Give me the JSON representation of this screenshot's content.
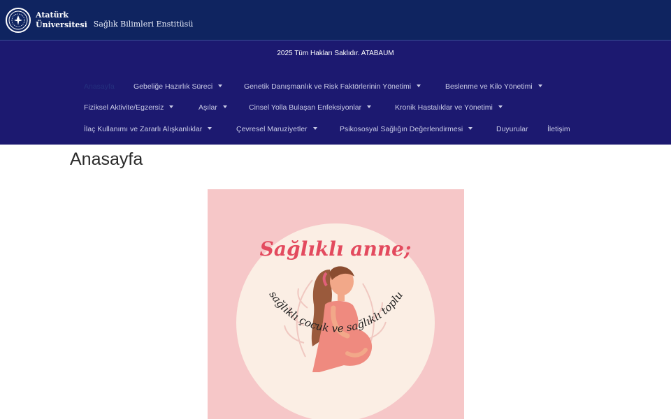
{
  "header": {
    "logo_line1": "Atatürk",
    "logo_line2": "Üniversitesi",
    "institute": "Sağlık Bilimleri Enstitüsü"
  },
  "nav": {
    "copyright": "2025 Tüm Hakları Saklıdır. ATABAUM",
    "home": "Anasayfa",
    "row1": [
      {
        "label": "Gebeliğe Hazırlık Süreci",
        "dropdown": true
      },
      {
        "label": "Genetik Danışmanlık ve Risk Faktörlerinin Yönetimi",
        "dropdown": true
      },
      {
        "label": "Beslenme ve Kilo Yönetimi",
        "dropdown": true
      }
    ],
    "row2": [
      {
        "label": "Fiziksel Aktivite/Egzersiz",
        "dropdown": true
      },
      {
        "label": "Aşılar",
        "dropdown": true
      },
      {
        "label": "Cinsel Yolla Bulaşan Enfeksiyonlar",
        "dropdown": true
      },
      {
        "label": "Kronik Hastalıklar ve Yönetimi",
        "dropdown": true
      }
    ],
    "row3": [
      {
        "label": "İlaç Kullanımı ve Zararlı Alışkanlıklar",
        "dropdown": true
      },
      {
        "label": "Çevresel Maruziyetler",
        "dropdown": true
      },
      {
        "label": "Psikososyal Sağlığın Değerlendirmesi",
        "dropdown": true
      },
      {
        "label": "Duyurular",
        "dropdown": false
      },
      {
        "label": "İletişim",
        "dropdown": false
      }
    ]
  },
  "main": {
    "title": "Anasayfa",
    "poster": {
      "headline": "Sağlıklı anne;",
      "circle_text": "sağlıklı çocuk ve sağlıklı toplum demektir"
    }
  },
  "colors": {
    "header_bg": "#0f2460",
    "nav_bg": "#1c1970",
    "poster_bg": "#f6c7c8",
    "headline": "#e34a5e"
  }
}
